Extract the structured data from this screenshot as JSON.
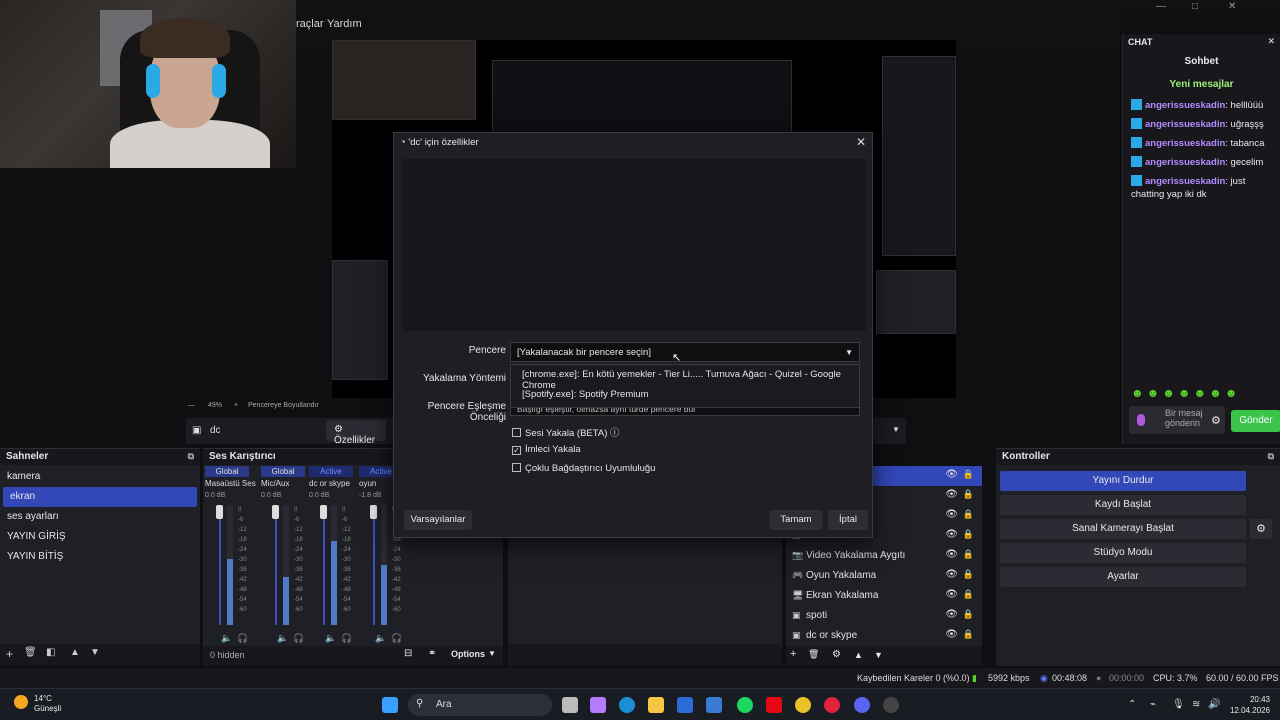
{
  "menubar": {
    "items": [
      "raçlar",
      "Yardım"
    ]
  },
  "window_controls": {
    "minimize": "—",
    "maximize": "□",
    "close": "✕"
  },
  "preview": {
    "scale_text": "49%",
    "fit_text": "Pencereye Boyutlandır"
  },
  "source_toolbar": {
    "source_name": "dc",
    "properties_label": "Özellikler"
  },
  "scenes": {
    "title": "Sahneler",
    "items": [
      "kamera",
      "ekran",
      "ses ayarları",
      "YAYIN GİRİŞ",
      "YAYIN BİTİŞ"
    ],
    "active_index": 1
  },
  "mixer": {
    "title": "Ses Karıştırıcı",
    "channels": [
      {
        "head": "Global",
        "name": "Masaüstü Ses",
        "db": "0.0 dB",
        "level": 0.55
      },
      {
        "head": "Global",
        "name": "Mic/Aux",
        "db": "0.0 dB",
        "level": 0.4
      },
      {
        "head": "Active",
        "name": "dc or skype",
        "db": "0.0 dB",
        "level": 0.7
      },
      {
        "head": "Active",
        "name": "oyun",
        "db": "-1.8 dB",
        "level": 0.5
      }
    ],
    "scale": [
      "0",
      "-6",
      "-12",
      "-18",
      "-24",
      "-30",
      "-36",
      "-42",
      "-48",
      "-54",
      "-60"
    ],
    "hidden_label": "0 hidden",
    "options_label": "Options"
  },
  "sources": {
    "items": [
      "",
      "",
      "",
      "",
      "Video Yakalama Aygıtı",
      "Oyun Yakalama",
      "Ekran Yakalama",
      "spoti",
      "dc or skype"
    ]
  },
  "controls": {
    "title": "Kontroller",
    "buttons": [
      "Yayını Durdur",
      "Kaydı Başlat",
      "Sanal Kamerayı Başlat",
      "Stüdyo Modu",
      "Ayarlar"
    ]
  },
  "status": {
    "dropped": "Kaybedilen Kareler 0 (%0.0)",
    "bitrate": "5992 kbps",
    "stream_time": "00:48:08",
    "rec_time": "00:00:00",
    "cpu": "CPU: 3.7%",
    "fps": "60.00 / 60.00 FPS"
  },
  "chat": {
    "header": "CHAT",
    "title": "Sohbet",
    "new_messages": "Yeni mesajlar",
    "messages": [
      {
        "user": "angerissueskadin",
        "text": ": helllüüü"
      },
      {
        "user": "angerissueskadin",
        "text": ": uğraşşş"
      },
      {
        "user": "angerissueskadin",
        "text": ": tabanca"
      },
      {
        "user": "angerissueskadin",
        "text": ": gecelim"
      },
      {
        "user": "angerissueskadin",
        "text": ": just chatting yap iki dk"
      }
    ],
    "input_placeholder": "Bir mesaj gönderin",
    "send_label": "Gönder"
  },
  "dialog": {
    "title": "'dc' için özellikler",
    "window_label": "Pencere",
    "window_value": "[Yakalanacak bir pencere seçin]",
    "dropdown_options": [
      "[chrome.exe]: En kötü yemekler - Tier Li..... Turnuva Ağacı - Quizel - Google Chrome",
      "[Spotify.exe]: Spotify Premium"
    ],
    "capture_method_label": "Yakalama Yöntemi",
    "match_label": "Pencere Eşleşme Önceliği",
    "match_value": "Başlığı eşleştir, olmazsa aynı türde pencere bul",
    "checkboxes": [
      {
        "label": "Sesi Yakala (BETA)",
        "checked": false
      },
      {
        "label": "İmleci Yakala",
        "checked": true
      },
      {
        "label": "Çoklu Bağdaştırıcı Uyumluluğu",
        "checked": false
      }
    ],
    "defaults_label": "Varsayılanlar",
    "ok_label": "Tamam",
    "cancel_label": "İptal"
  },
  "taskbar": {
    "weather_temp": "14°C",
    "weather_desc": "Güneşli",
    "search_placeholder": "Ara",
    "time": "20:43",
    "date": "12.04.2026"
  }
}
